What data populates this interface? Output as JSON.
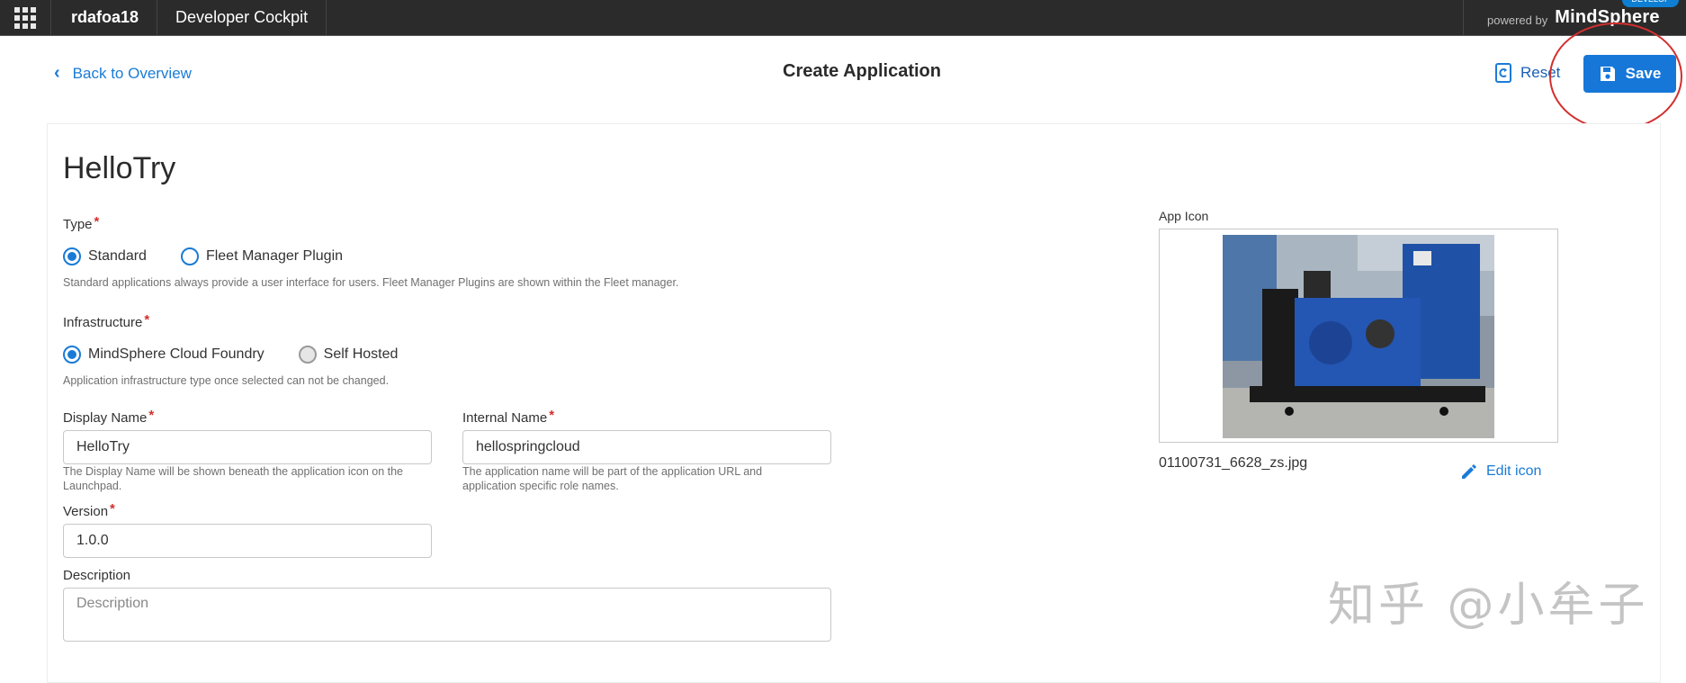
{
  "topbar": {
    "tenant": "rdafoa18",
    "app_name": "Developer Cockpit",
    "powered_by": "powered by",
    "brand": "MindSphere",
    "env_badge": "DEVELOP"
  },
  "header": {
    "back_label": "Back to Overview",
    "title": "Create Application",
    "reset_label": "Reset",
    "save_label": "Save"
  },
  "form": {
    "app_name_heading": "HelloTry",
    "type": {
      "label": "Type",
      "required": "*",
      "options": [
        "Standard",
        "Fleet Manager Plugin"
      ],
      "selected": "Standard",
      "hint": "Standard applications always provide a user interface for users. Fleet Manager Plugins are shown within the Fleet manager."
    },
    "infrastructure": {
      "label": "Infrastructure",
      "required": "*",
      "options": [
        "MindSphere Cloud Foundry",
        "Self Hosted"
      ],
      "selected": "MindSphere Cloud Foundry",
      "hint": "Application infrastructure type once selected can not be changed."
    },
    "display_name": {
      "label": "Display Name",
      "required": "*",
      "value": "HelloTry",
      "hint": "The Display Name will be shown beneath the application icon on the Launchpad."
    },
    "internal_name": {
      "label": "Internal Name",
      "required": "*",
      "value": "hellospringcloud",
      "hint": "The application name will be part of the application URL and application specific role names."
    },
    "version": {
      "label": "Version",
      "required": "*",
      "value": "1.0.0"
    },
    "description": {
      "label": "Description",
      "placeholder": "Description",
      "value": ""
    }
  },
  "app_icon": {
    "label": "App Icon",
    "image_name": "generator-image",
    "filename": "01100731_6628_zs.jpg",
    "edit_label": "Edit icon"
  },
  "watermark": "知乎 @小牟子",
  "colors": {
    "accent": "#1677d9",
    "link": "#1a7bd6",
    "topbar": "#2b2b2b",
    "required": "#d32f2f",
    "annotation": "#d32f2f"
  }
}
